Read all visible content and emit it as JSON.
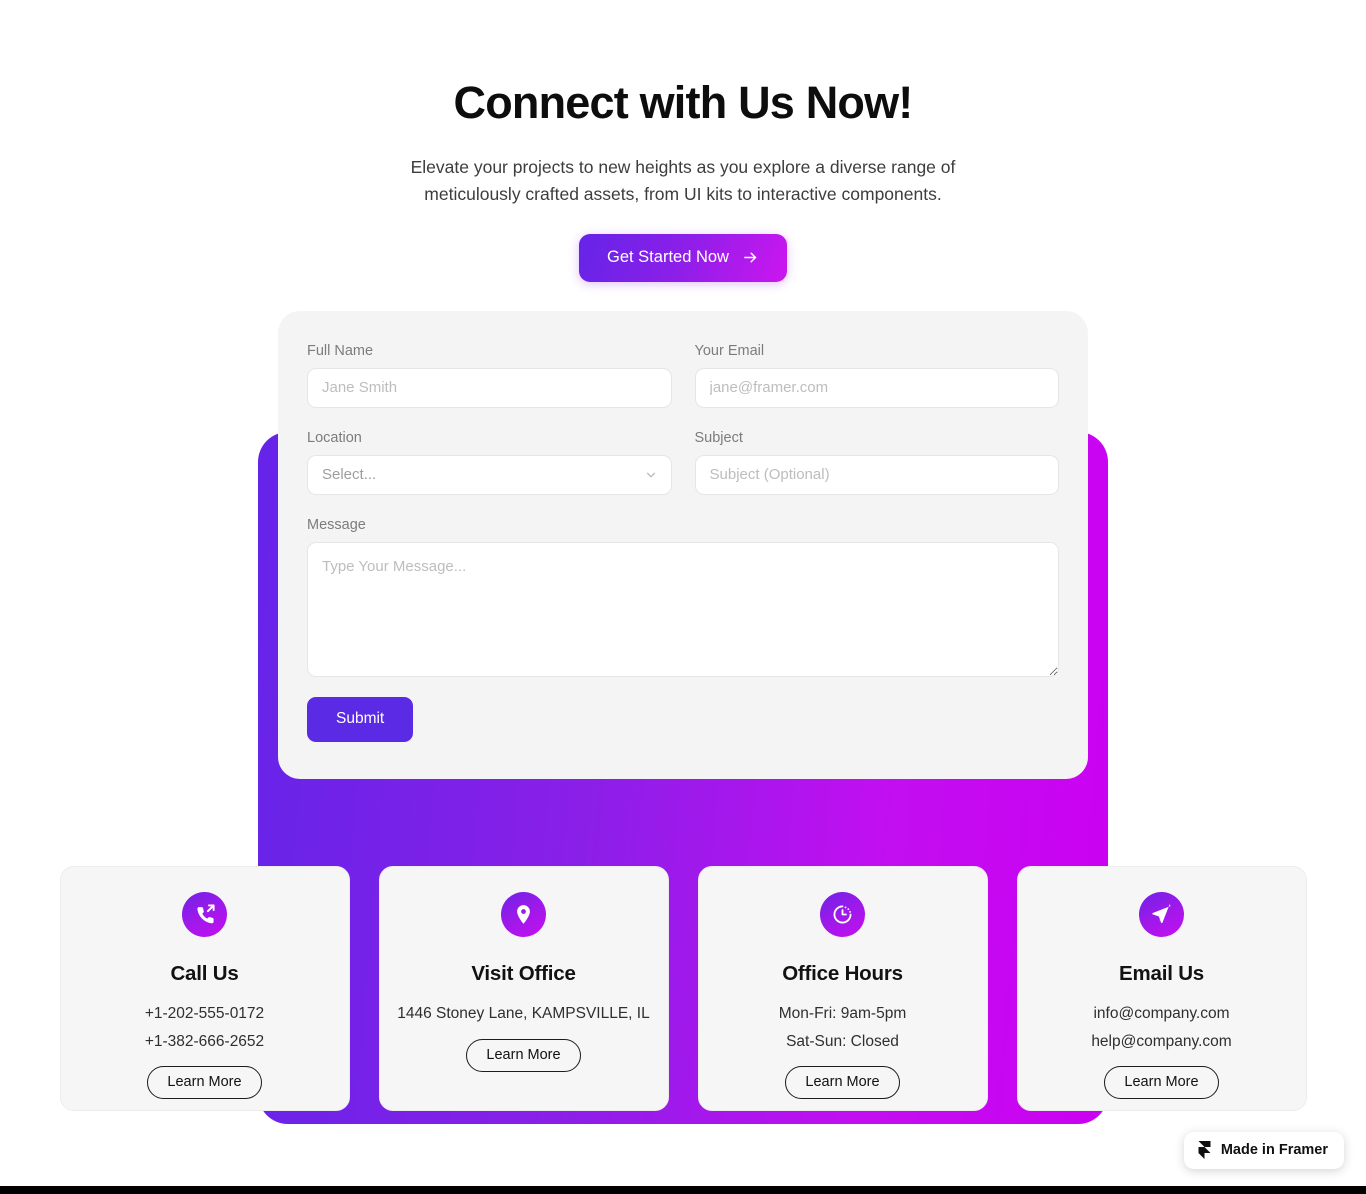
{
  "hero": {
    "title": "Connect with Us Now!",
    "subtitle": "Elevate your projects to new heights as you explore a diverse range of meticulously crafted assets, from UI kits to interactive components.",
    "cta_label": "Get Started Now",
    "cta_icon": "arrow-right-icon"
  },
  "form": {
    "full_name": {
      "label": "Full Name",
      "placeholder": "Jane Smith",
      "value": ""
    },
    "email": {
      "label": "Your Email",
      "placeholder": "jane@framer.com",
      "value": ""
    },
    "location": {
      "label": "Location",
      "selected": "Select...",
      "options": [
        "Select..."
      ]
    },
    "subject": {
      "label": "Subject",
      "placeholder": "Subject (Optional)",
      "value": ""
    },
    "message": {
      "label": "Message",
      "placeholder": "Type Your Message...",
      "value": ""
    },
    "submit_label": "Submit"
  },
  "cards": [
    {
      "icon": "phone-outgoing-icon",
      "title": "Call Us",
      "line1": "+1-202-555-0172",
      "line2": "+1-382-666-2652",
      "button": "Learn More"
    },
    {
      "icon": "map-pin-icon",
      "title": "Visit Office",
      "line1": "1446 Stoney Lane, KAMPSVILLE, IL",
      "line2": "",
      "button": "Learn More"
    },
    {
      "icon": "clock-timer-icon",
      "title": "Office Hours",
      "line1": "Mon-Fri: 9am-5pm",
      "line2": "Sat-Sun: Closed",
      "button": "Learn More"
    },
    {
      "icon": "send-plane-icon",
      "title": "Email Us",
      "line1": "info@company.com",
      "line2": "help@company.com",
      "button": "Learn More"
    }
  ],
  "badge": {
    "label": "Made in Framer",
    "icon": "framer-logo-icon"
  },
  "colors": {
    "gradient_start": "#6524e8",
    "gradient_end": "#cc00f2",
    "submit_purple": "#5b2ae5",
    "card_bg": "#f6f6f6",
    "form_bg": "#f4f4f4",
    "page_bg": "#ffffff"
  }
}
